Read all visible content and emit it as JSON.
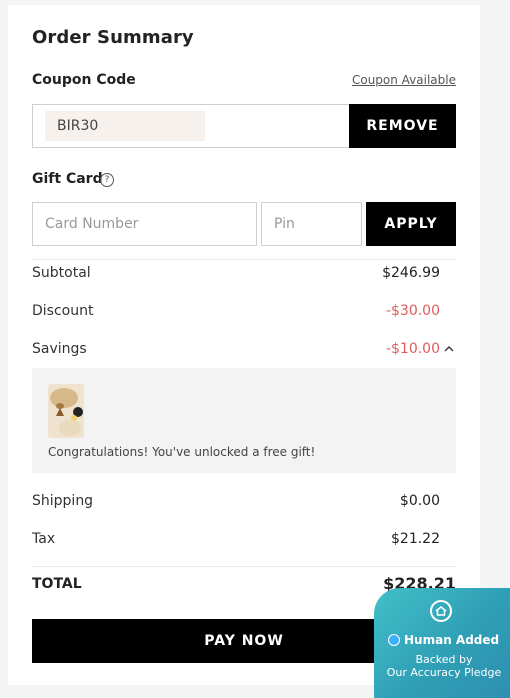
{
  "order_summary": {
    "title": "Order Summary"
  },
  "coupon": {
    "label": "Coupon Code",
    "available_link": "Coupon Available",
    "applied_code": "BIR30",
    "remove_label": "REMOVE"
  },
  "gift_card": {
    "label": "Gift Card",
    "card_number_placeholder": "Card Number",
    "pin_placeholder": "Pin",
    "apply_label": "APPLY"
  },
  "lines": {
    "subtotal_label": "Subtotal",
    "subtotal_value": "$246.99",
    "discount_label": "Discount",
    "discount_value": "-$30.00",
    "savings_label": "Savings",
    "savings_value": "-$10.00",
    "shipping_label": "Shipping",
    "shipping_value": "$0.00",
    "tax_label": "Tax",
    "tax_value": "$21.22"
  },
  "gift": {
    "message": "Congratulations! You've unlocked a free gift!"
  },
  "total": {
    "label": "TOTAL",
    "value": "$228.21"
  },
  "pay_label": "PAY NOW",
  "badge": {
    "title": "Human Added",
    "line2": "Backed by",
    "line3": "Our Accuracy Pledge"
  },
  "colors": {
    "negative": "#e35a5a",
    "button_bg": "#000000",
    "badge_bg": "#3aaebf"
  },
  "icons": {
    "help": "question-circle-icon",
    "chevron": "chevron-up-icon",
    "badge": "home-icon",
    "check": "check-circle-icon"
  }
}
